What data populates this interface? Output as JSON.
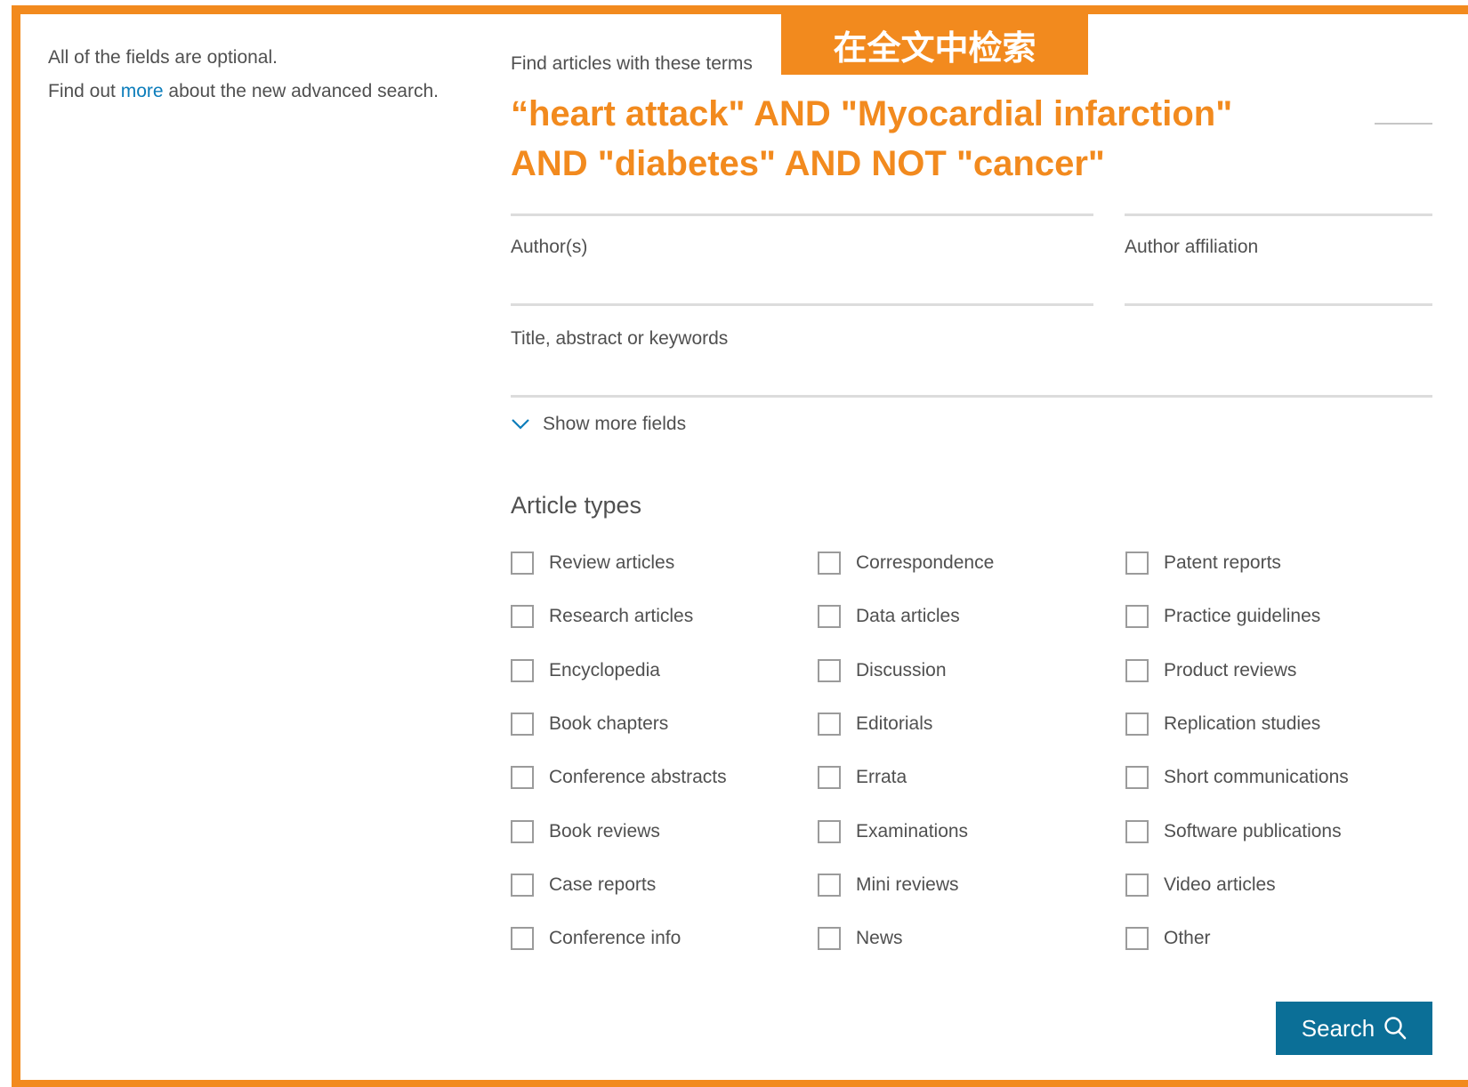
{
  "intro": {
    "line1": "All of the fields are optional.",
    "line2_prefix": "Find out ",
    "line2_link": "more",
    "line2_suffix": " about the new advanced search."
  },
  "annotation": {
    "banner": "在全文中检索"
  },
  "terms": {
    "label": "Find articles with these terms",
    "query_line1": "“heart attack\" AND \"Myocardial infarction\"",
    "query_line2": "AND \"diabetes\" AND NOT \"cancer\""
  },
  "fields": {
    "authors_label": "Author(s)",
    "affiliation_label": "Author affiliation",
    "title_abstract_label": "Title, abstract or keywords",
    "show_more": "Show more fields"
  },
  "article_types": {
    "heading": "Article types",
    "columns": [
      [
        "Review articles",
        "Research articles",
        "Encyclopedia",
        "Book chapters",
        "Conference abstracts",
        "Book reviews",
        "Case reports",
        "Conference info"
      ],
      [
        "Correspondence",
        "Data articles",
        "Discussion",
        "Editorials",
        "Errata",
        "Examinations",
        "Mini reviews",
        "News"
      ],
      [
        "Patent reports",
        "Practice guidelines",
        "Product reviews",
        "Replication studies",
        "Short communications",
        "Software publications",
        "Video articles",
        "Other"
      ]
    ]
  },
  "search_button": {
    "label": "Search",
    "icon": "search-icon"
  },
  "colors": {
    "annotation": "#f28a1e",
    "link": "#0c7dbb",
    "button": "#0b6f97"
  }
}
